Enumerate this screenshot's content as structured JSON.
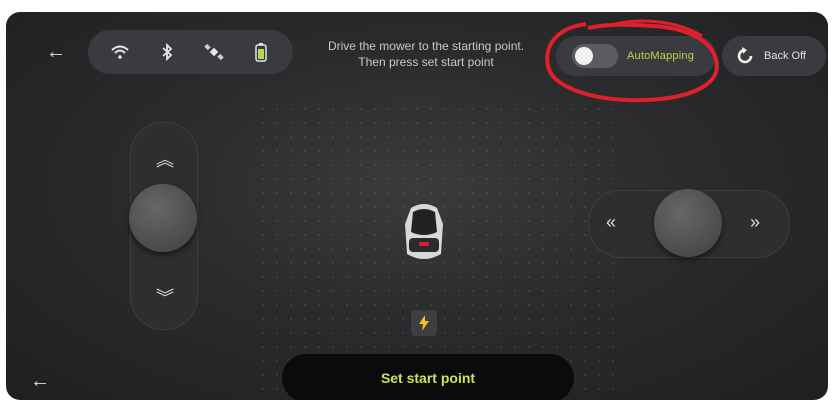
{
  "header": {
    "instruction_line1": "Drive the mower to the starting point.",
    "instruction_line2": "Then press set start point"
  },
  "status_icons": [
    "wifi-icon",
    "bluetooth-icon",
    "satellite-icon",
    "battery-icon"
  ],
  "auto_mapping": {
    "label": "AutoMapping",
    "enabled": false,
    "label_color": "#bcd44a"
  },
  "back_off": {
    "label": "Back Off"
  },
  "controls": {
    "up_glyph": "︽",
    "down_glyph": "︾",
    "left_glyph": "«",
    "right_glyph": "»"
  },
  "primary_action": {
    "label": "Set start point",
    "label_color": "#c7e65a"
  },
  "annotation": {
    "color": "#e0202a"
  }
}
